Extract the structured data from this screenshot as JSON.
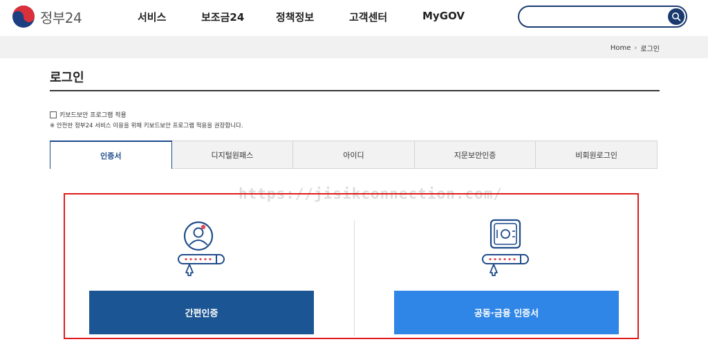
{
  "header": {
    "logo_text": "정부24",
    "nav": [
      {
        "label": "서비스"
      },
      {
        "label": "보조금24"
      },
      {
        "label": "정책정보"
      },
      {
        "label": "고객센터"
      },
      {
        "label": "MyGOV"
      }
    ],
    "search": {
      "placeholder": ""
    }
  },
  "breadcrumb": {
    "home": "Home",
    "current": "로그인"
  },
  "page_title": "로그인",
  "keyboard_security": {
    "label": "키보드보안 프로그램 적용",
    "notice": "※ 안전한 정부24 서비스 이용을 위해 키보드보안 프로그램 적용을 권장합니다."
  },
  "tabs": [
    {
      "label": "인증서",
      "active": true
    },
    {
      "label": "디지털원패스",
      "active": false
    },
    {
      "label": "아이디",
      "active": false
    },
    {
      "label": "지문보안인증",
      "active": false
    },
    {
      "label": "비회원로그인",
      "active": false
    }
  ],
  "watermark": "https://jisikconnection.com/",
  "auth_options": {
    "simple_label": "간편인증",
    "cert_label": "공동·금융 인증서"
  },
  "colors": {
    "brand_navy": "#1a3a6e",
    "simple_button": "#1c5593",
    "cert_button": "#2f86e6",
    "highlight_frame": "#e01a1a"
  }
}
